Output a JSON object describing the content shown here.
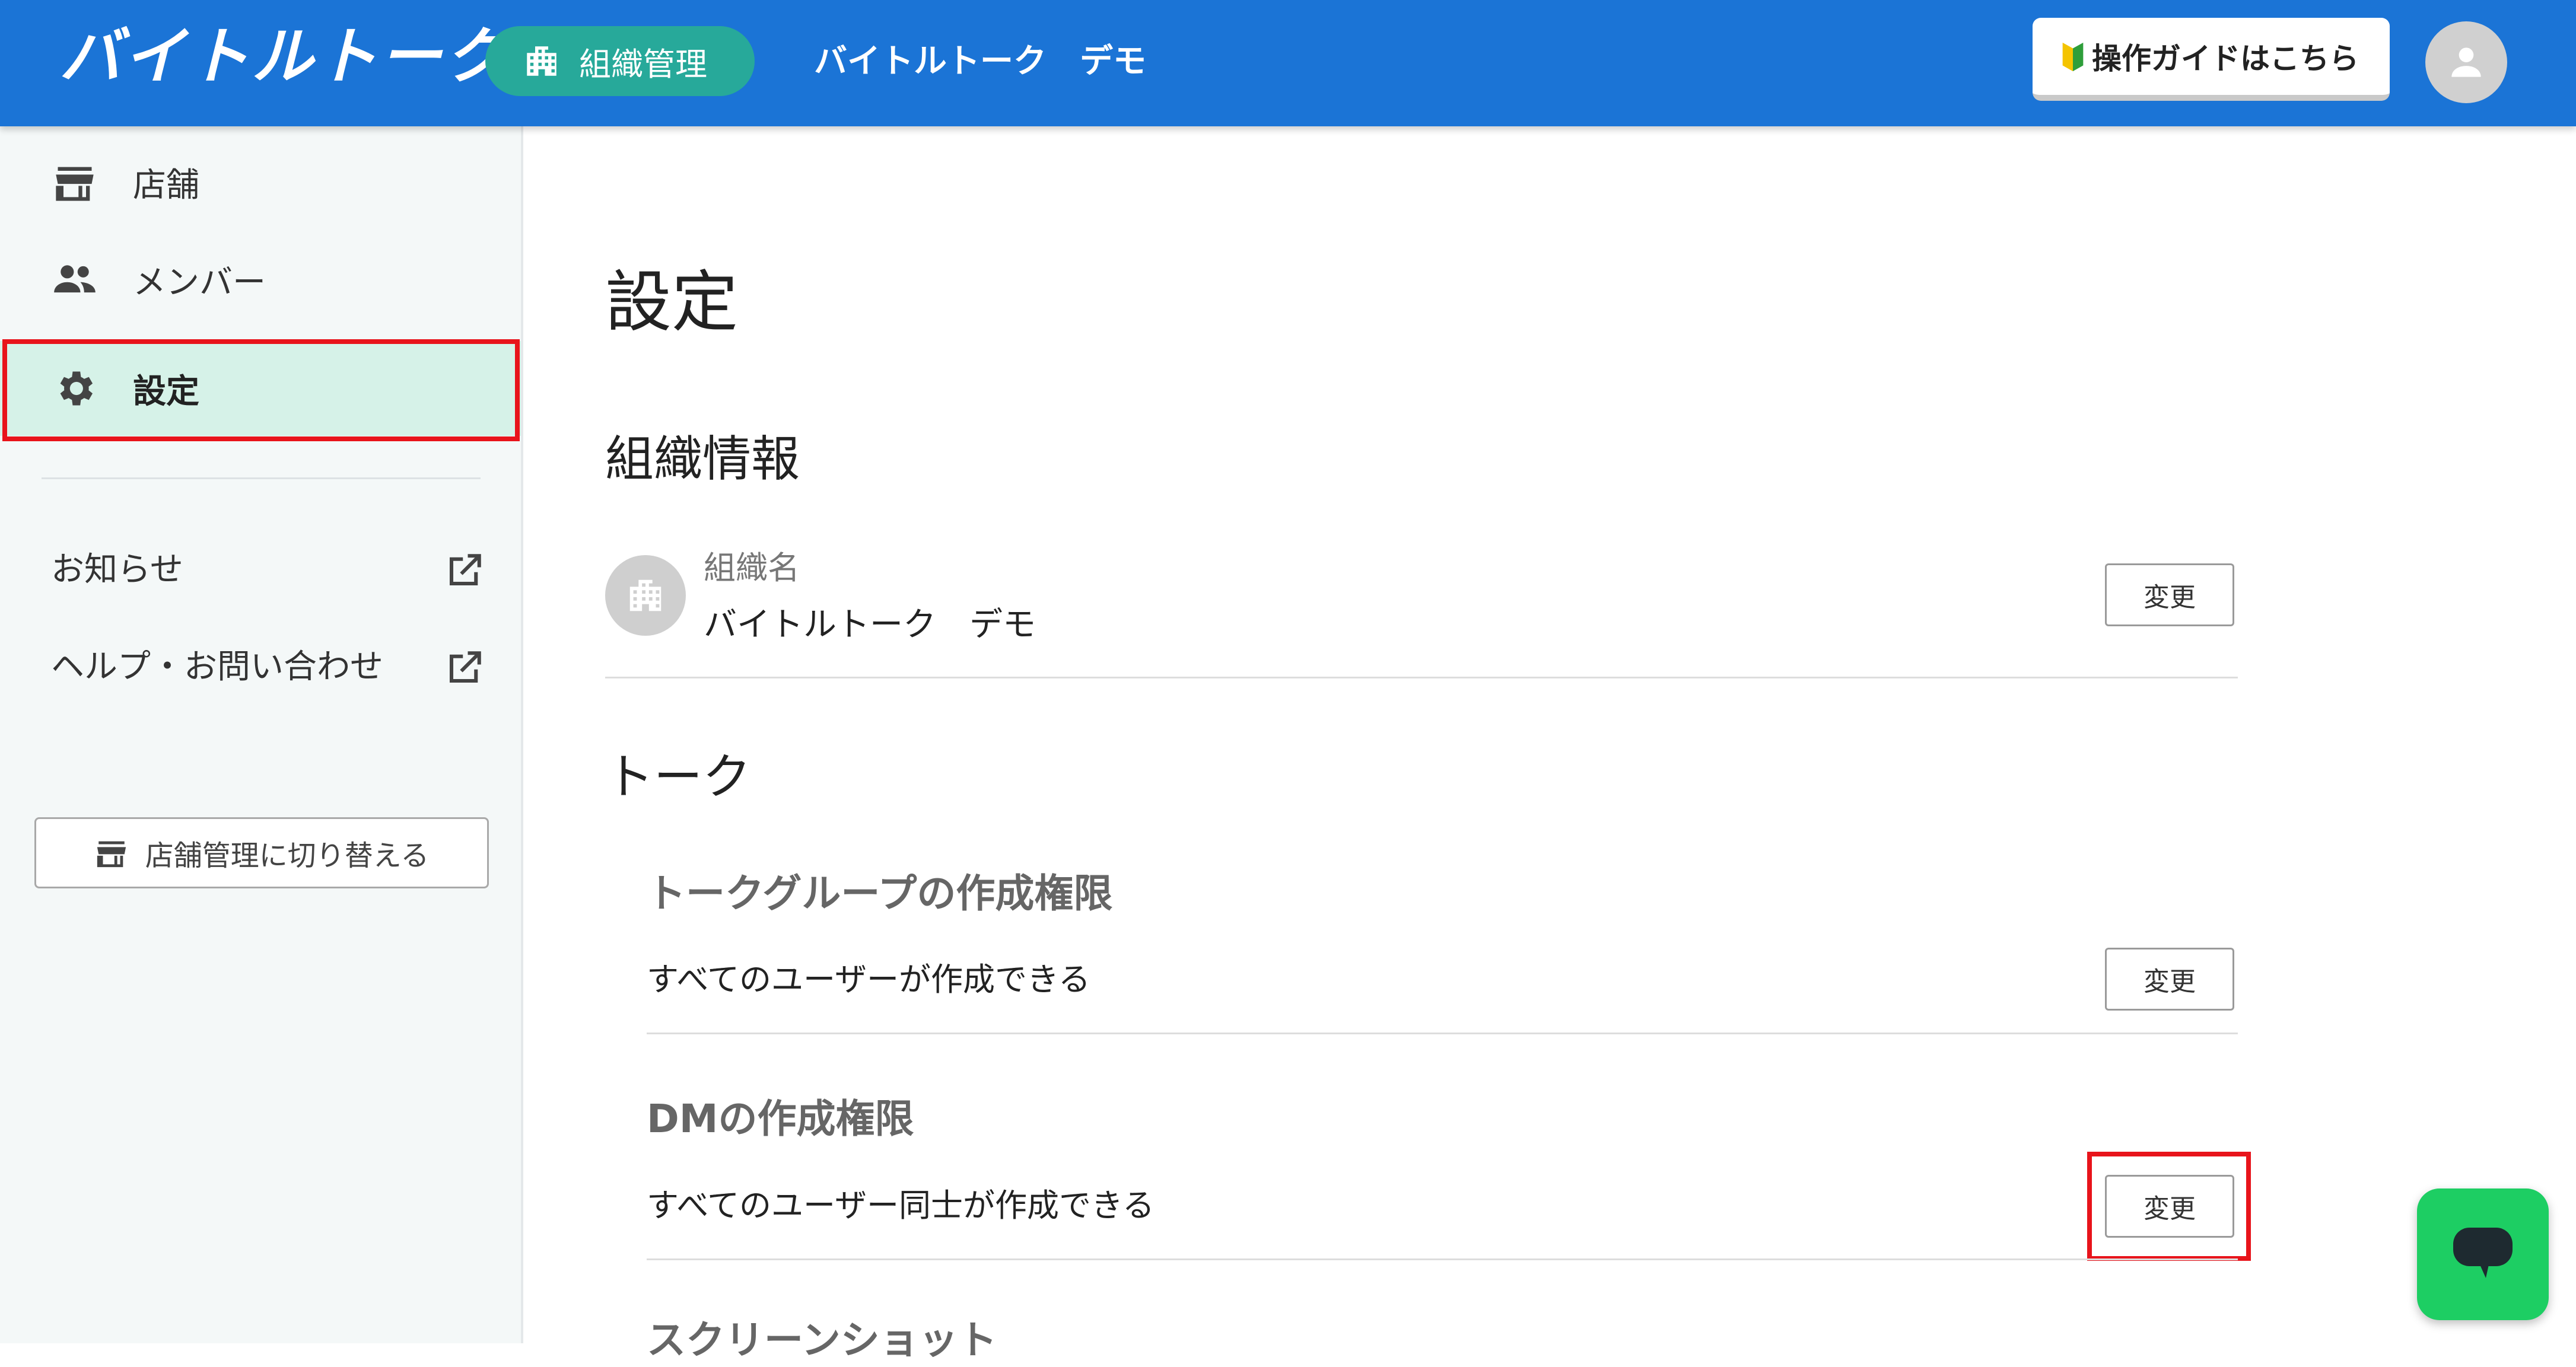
{
  "header": {
    "logo": "バイトルトーク",
    "org_mode_label": "組織管理",
    "org_name": "バイトルトーク　デモ",
    "guide_label": "操作ガイドはこちら",
    "accent": "#1b74d6",
    "pill_color": "#27a99a"
  },
  "sidebar": {
    "items": [
      {
        "label": "店舗",
        "icon": "store-icon"
      },
      {
        "label": "メンバー",
        "icon": "people-icon"
      },
      {
        "label": "設定",
        "icon": "gear-icon",
        "active": true
      }
    ],
    "external_links": [
      {
        "label": "お知らせ",
        "icon": "open-in-new-icon"
      },
      {
        "label": "ヘルプ・お問い合わせ",
        "icon": "open-in-new-icon"
      }
    ],
    "switch_label": "店舗管理に切り替える",
    "active_bg": "#d6f2e8"
  },
  "main": {
    "title": "設定",
    "org_section": {
      "title": "組織情報",
      "field_label": "組織名",
      "field_value": "バイトルトーク　デモ",
      "change_label": "変更"
    },
    "talk_section": {
      "title": "トーク",
      "settings": [
        {
          "title": "トークグループの作成権限",
          "value": "すべてのユーザーが作成できる",
          "change_label": "変更"
        },
        {
          "title": "DMの作成権限",
          "value": "すべてのユーザー同士が作成できる",
          "change_label": "変更"
        }
      ],
      "next_title": "スクリーンショット"
    }
  },
  "highlight_color": "#e8141b",
  "chat_button_color": "#1dce63"
}
